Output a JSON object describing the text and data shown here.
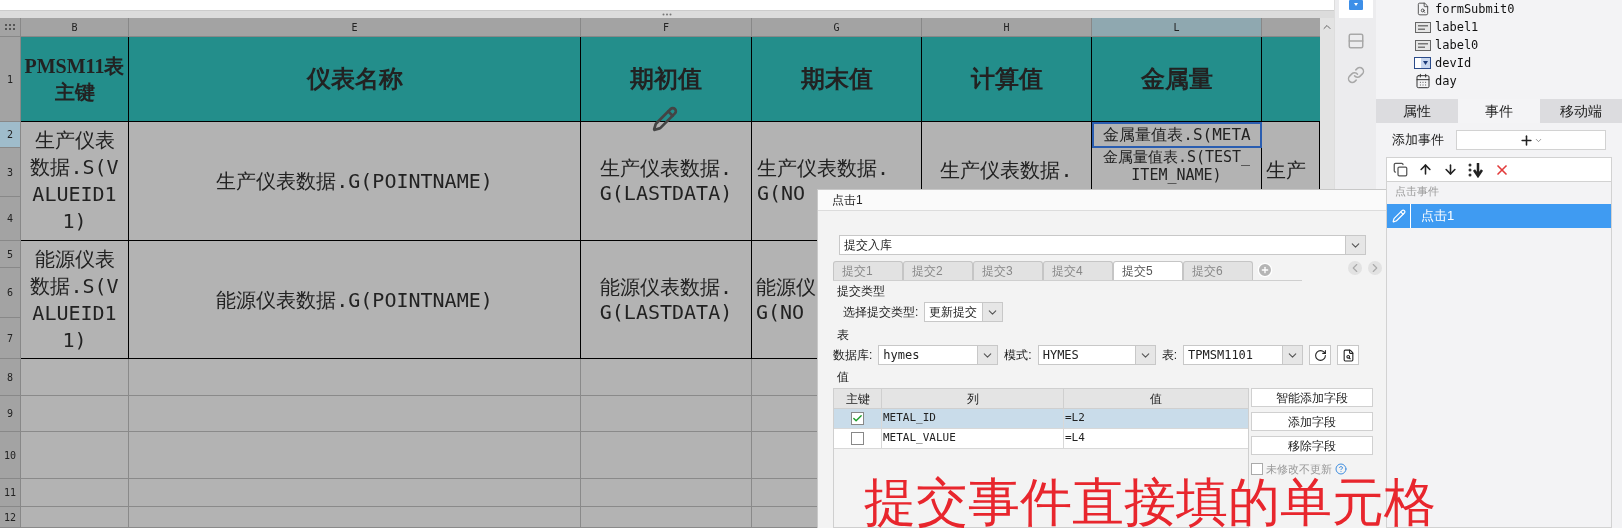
{
  "sheet": {
    "columns": [
      {
        "label": "B",
        "selected": false
      },
      {
        "label": "E",
        "selected": false
      },
      {
        "label": "F",
        "selected": false
      },
      {
        "label": "G",
        "selected": false
      },
      {
        "label": "H",
        "selected": false
      },
      {
        "label": "L",
        "selected": true
      }
    ],
    "row_numbers": [
      {
        "label": "1",
        "selected": false
      },
      {
        "label": "2",
        "selected": true
      },
      {
        "label": "3",
        "selected": false
      },
      {
        "label": "4",
        "selected": false
      },
      {
        "label": "5",
        "selected": false
      },
      {
        "label": "6",
        "selected": false
      },
      {
        "label": "7",
        "selected": false
      },
      {
        "label": "8",
        "selected": false
      },
      {
        "label": "9",
        "selected": false
      },
      {
        "label": "10",
        "selected": false
      },
      {
        "label": "11",
        "selected": false
      },
      {
        "label": "12",
        "selected": false
      }
    ],
    "header_cells": [
      "PMSM11表主键",
      "仪表名称",
      "期初值",
      "期末值",
      "计算值",
      "金属量"
    ],
    "groups": [
      {
        "cells": [
          {
            "text": "生产仪表数据.S(VALUEID11)",
            "selected": false
          },
          {
            "text": "生产仪表数据.G(POINTNAME)",
            "selected": false
          },
          {
            "text": "生产仪表数据.\nG(LASTDATA)",
            "selected": false
          },
          {
            "text": "生产仪表数据.\nG(NO",
            "selected": false
          },
          {
            "text": "生产仪表数据.",
            "selected": false
          },
          {
            "text": "金属量值表.S(META",
            "selected": true
          },
          {
            "text": "金属量值表.S(TEST_\nITEM_NAME)",
            "selected": false
          },
          {
            "text": "生产",
            "selected": false
          }
        ]
      },
      {
        "cells": [
          {
            "text": "能源仪表数据.S(VALUEID11)",
            "selected": false
          },
          {
            "text": "能源仪表数据.G(POINTNAME)",
            "selected": false
          },
          {
            "text": "能源仪表数据.\nG(LASTDATA)",
            "selected": false
          },
          {
            "text": "能源仪\nG(NO",
            "selected": false
          }
        ]
      }
    ]
  },
  "component_tree": {
    "items": [
      {
        "kind": "form",
        "label": "formSubmit0"
      },
      {
        "kind": "label",
        "label": "label1"
      },
      {
        "kind": "label",
        "label": "label0"
      },
      {
        "kind": "combo",
        "label": "devId"
      },
      {
        "kind": "date",
        "label": "day"
      }
    ]
  },
  "panel_tabs": [
    {
      "label": "属性",
      "selected": false
    },
    {
      "label": "事件",
      "selected": true
    },
    {
      "label": "移动端",
      "selected": false
    }
  ],
  "add_event": {
    "label": "添加事件"
  },
  "event_list": {
    "group": "点击事件",
    "items": [
      {
        "label": "点击1",
        "selected": true
      }
    ]
  },
  "dialog": {
    "title": "点击1",
    "action": "提交入库",
    "tabs": [
      {
        "label": "提交1",
        "selected": false
      },
      {
        "label": "提交2",
        "selected": false
      },
      {
        "label": "提交3",
        "selected": false
      },
      {
        "label": "提交4",
        "selected": false
      },
      {
        "label": "提交5",
        "selected": true
      },
      {
        "label": "提交6",
        "selected": false
      }
    ],
    "submit_type": {
      "section": "提交类型",
      "label": "选择提交类型:",
      "value": "更新提交"
    },
    "table_section": {
      "section": "表",
      "database_label": "数据库:",
      "database": "hymes",
      "schema_label": "模式:",
      "schema": "HYMES",
      "table_label": "表:",
      "table": "TPMSM1101"
    },
    "values": {
      "section": "值",
      "columns": [
        "主键",
        "列",
        "值"
      ],
      "rows": [
        {
          "key": true,
          "column": "METAL_ID",
          "value": "=L2",
          "selected": true
        },
        {
          "key": false,
          "column": "METAL_VALUE",
          "value": "=L4",
          "selected": false
        }
      ]
    },
    "buttons": [
      "智能添加字段",
      "添加字段",
      "移除字段"
    ],
    "no_update": {
      "label": "未修改不更新",
      "checked": false
    }
  },
  "annotation": "提交事件直接填的单元格"
}
